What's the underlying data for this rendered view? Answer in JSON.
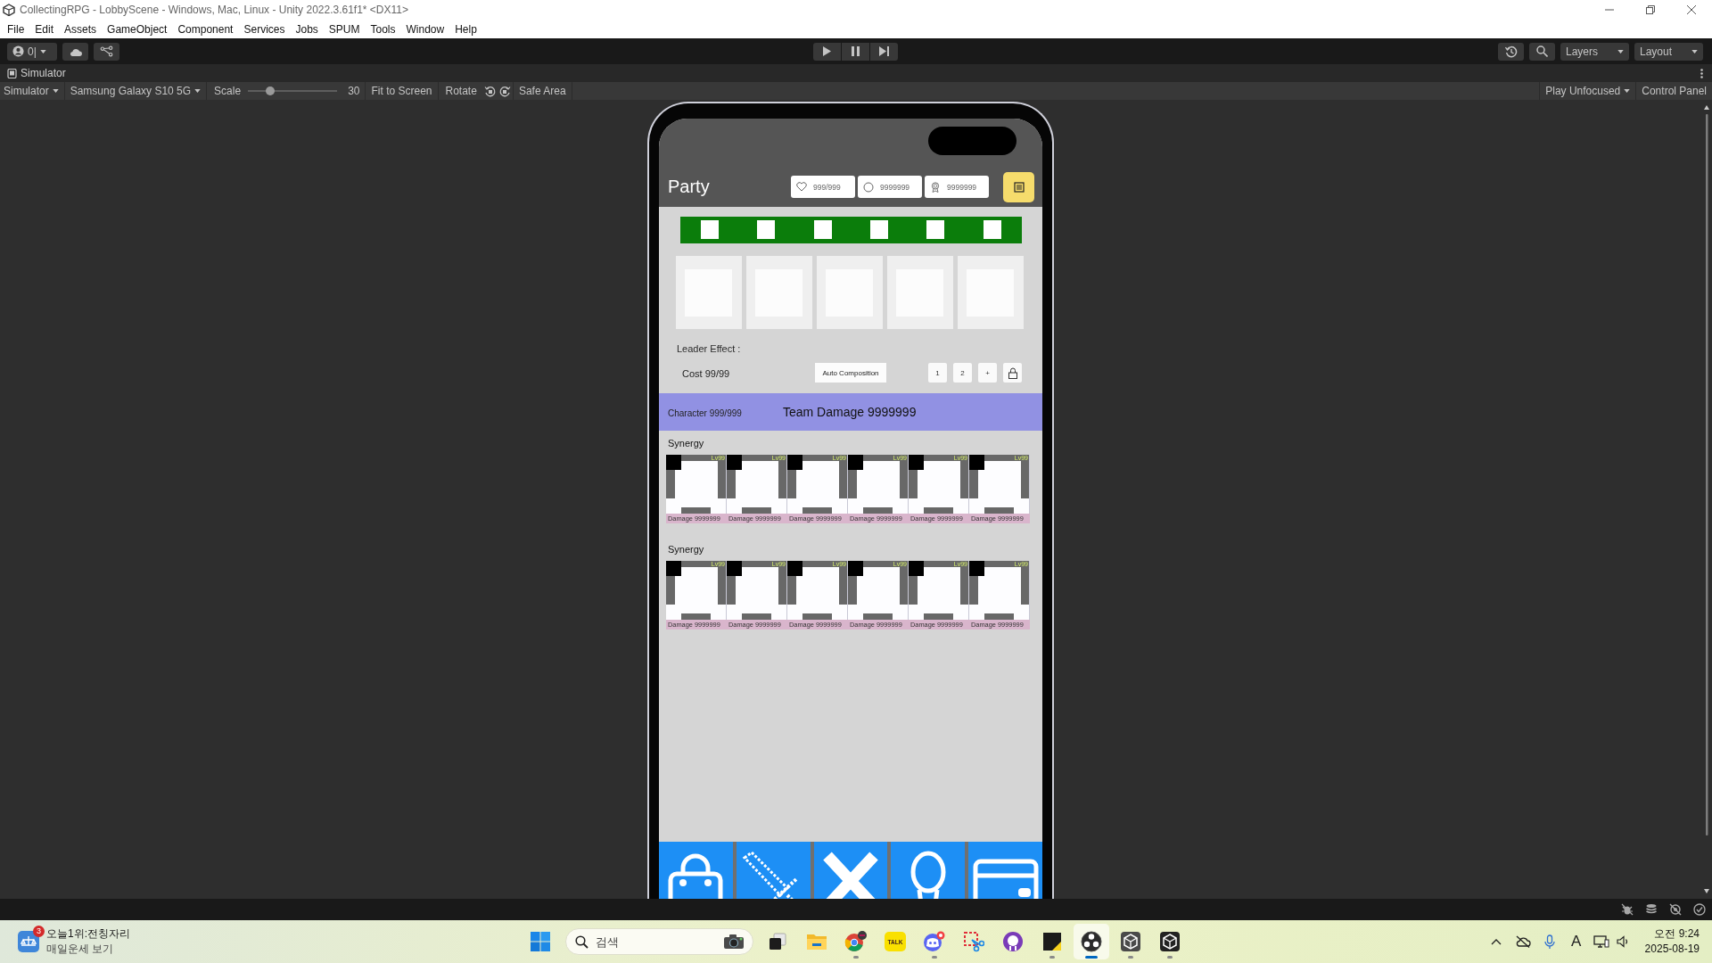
{
  "window": {
    "title": "CollectingRPG - LobbyScene - Windows, Mac, Linux - Unity 2022.3.61f1* <DX11>"
  },
  "menu": [
    "File",
    "Edit",
    "Assets",
    "GameObject",
    "Component",
    "Services",
    "Jobs",
    "SPUM",
    "Tools",
    "Window",
    "Help"
  ],
  "toolbar": {
    "account": "0|",
    "layers": "Layers",
    "layout": "Layout"
  },
  "simulator": {
    "tab": "Simulator",
    "mode": "Simulator",
    "device": "Samsung Galaxy S10 5G",
    "scale_label": "Scale",
    "scale": {
      "level": 0.25
    },
    "scale_value": "30",
    "fit_button": "Fit to Screen",
    "rotate_label": "Rotate",
    "safe_area": "Safe Area",
    "play_mode": "Play Unfocused",
    "control_panel": "Control Panel"
  },
  "game": {
    "title": "Party",
    "resources": [
      {
        "value": "999/999"
      },
      {
        "value": "9999999"
      },
      {
        "value": "9999999"
      }
    ],
    "leader_effect": "Leader Effect :",
    "cost": "Cost 99/99",
    "auto_button": "Auto Composition",
    "preset_buttons": [
      "1",
      "2",
      "+"
    ],
    "characters": "Character 999/999",
    "team_damage": "Team Damage 9999999",
    "synergy_groups": [
      {
        "title": "Synergy",
        "units": [
          {
            "tag": "Lv99",
            "damage": "Damage 9999999"
          },
          {
            "tag": "Lv99",
            "damage": "Damage 9999999"
          },
          {
            "tag": "Lv99",
            "damage": "Damage 9999999"
          },
          {
            "tag": "Lv99",
            "damage": "Damage 9999999"
          },
          {
            "tag": "Lv99",
            "damage": "Damage 9999999"
          },
          {
            "tag": "Lv99",
            "damage": "Damage 9999999"
          }
        ]
      },
      {
        "title": "Synergy",
        "units": [
          {
            "tag": "Lv99",
            "damage": "Damage 9999999"
          },
          {
            "tag": "Lv99",
            "damage": "Damage 9999999"
          },
          {
            "tag": "Lv99",
            "damage": "Damage 9999999"
          },
          {
            "tag": "Lv99",
            "damage": "Damage 9999999"
          },
          {
            "tag": "Lv99",
            "damage": "Damage 9999999"
          },
          {
            "tag": "Lv99",
            "damage": "Damage 9999999"
          }
        ]
      }
    ]
  },
  "taskbar": {
    "widget": {
      "badge": "3",
      "headline": "오늘1위:전칭자리",
      "subline": "매일운세 보기"
    },
    "search": {
      "placeholder": "검색"
    },
    "apps": [
      {
        "running": false,
        "active": false
      },
      {
        "running": false,
        "active": false
      },
      {
        "running": true,
        "active": false
      },
      {
        "running": false,
        "active": false,
        "logo_text": "TALK"
      },
      {
        "running": true,
        "active": false
      },
      {
        "running": false,
        "active": false
      },
      {
        "running": false,
        "active": false
      },
      {
        "running": true,
        "active": false
      },
      {
        "running": true,
        "active": true
      },
      {
        "running": true,
        "active": false
      },
      {
        "running": true,
        "active": false
      }
    ],
    "ime": "A",
    "clock": {
      "time": "오전 9:24",
      "date": "2025-08-19"
    }
  }
}
